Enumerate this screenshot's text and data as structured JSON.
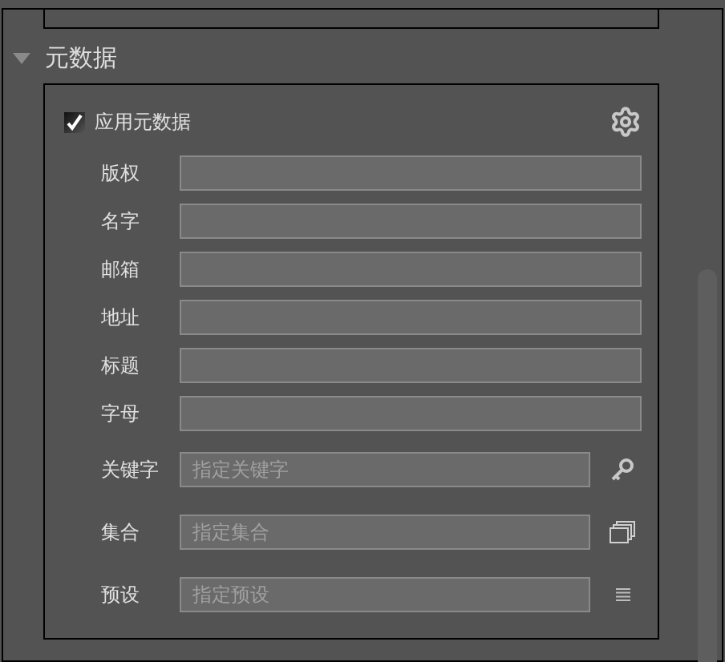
{
  "section": {
    "title": "元数据",
    "expanded": true
  },
  "apply": {
    "label": "应用元数据",
    "checked": true
  },
  "fields": [
    {
      "label": "版权",
      "kind": "plain"
    },
    {
      "label": "名字",
      "kind": "plain"
    },
    {
      "label": "邮箱",
      "kind": "plain"
    },
    {
      "label": "地址",
      "kind": "plain"
    },
    {
      "label": "标题",
      "kind": "plain"
    },
    {
      "label": "字母",
      "kind": "plain"
    },
    {
      "label": "关键字",
      "kind": "picker",
      "placeholder": "指定关键字"
    },
    {
      "label": "集合",
      "kind": "picker",
      "placeholder": "指定集合"
    },
    {
      "label": "预设",
      "kind": "picker",
      "placeholder": "指定预设"
    }
  ]
}
